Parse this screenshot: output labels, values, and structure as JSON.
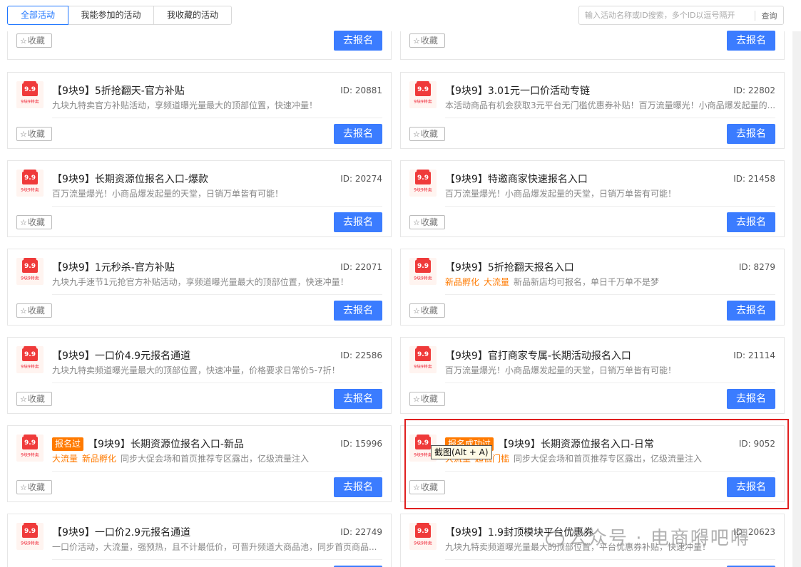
{
  "tabs": [
    {
      "label": "全部活动"
    },
    {
      "label": "我能参加的活动"
    },
    {
      "label": "我收藏的活动"
    }
  ],
  "search": {
    "placeholder": "输入活动名称或ID搜索，多个ID以逗号隔开",
    "button": "查询"
  },
  "common": {
    "fav_label": "收藏",
    "enroll_label": "去报名",
    "logo_text": "9.9",
    "logo_sub": "9块9特卖"
  },
  "cards": [
    {
      "title": "",
      "id": "",
      "desc": ""
    },
    {
      "title": "",
      "id": "",
      "desc": ""
    },
    {
      "title": "【9块9】5折抢翻天-官方补贴",
      "id": "ID: 20881",
      "desc": "九块九特卖官方补贴活动，享频道曝光量最大的顶部位置，快速冲量！"
    },
    {
      "title": "【9块9】3.01元一口价活动专链",
      "id": "ID: 22802",
      "desc": "本活动商品有机会获取3元平台无门槛优惠券补贴！百万流量曝光！小商品爆发起量的..."
    },
    {
      "title": "【9块9】长期资源位报名入口-爆款",
      "id": "ID: 20274",
      "desc": "百万流量爆光！小商品爆发起量的天堂，日销万单皆有可能！"
    },
    {
      "title": "【9块9】特邀商家快速报名入口",
      "id": "ID: 21458",
      "desc": "百万流量爆光！小商品爆发起量的天堂，日销万单皆有可能！"
    },
    {
      "title": "【9块9】1元秒杀-官方补贴",
      "id": "ID: 22071",
      "desc": "九块九手速节1元抢官方补贴活动，享频道曝光量最大的顶部位置，快速冲量！"
    },
    {
      "title": "【9块9】5折抢翻天报名入口",
      "id": "ID: 8279",
      "tags": [
        "新品孵化",
        "大流量"
      ],
      "desc": "新品新店均可报名，单日千万单不是梦"
    },
    {
      "title": "【9块9】一口价4.9元报名通道",
      "id": "ID: 22586",
      "desc": "九块九特卖频道曝光量最大的顶部位置，快速冲量，价格要求日常价5-7折！"
    },
    {
      "title": "【9块9】官打商家专属-长期活动报名入口",
      "id": "ID: 21114",
      "desc": "百万流量爆光！小商品爆发起量的天堂，日销万单皆有可能！"
    },
    {
      "badge": "报名过",
      "title": "【9块9】长期资源位报名入口-新品",
      "id": "ID: 15996",
      "tags": [
        "大流量",
        "新品孵化"
      ],
      "desc": "同步大促会场和首页推荐专区露出，亿级流量注入"
    },
    {
      "badge": "报名成功过",
      "title": "【9块9】长期资源位报名入口-日常",
      "id": "ID: 9052",
      "tags": [
        "大流量",
        "超低门槛"
      ],
      "desc": "同步大促会场和首页推荐专区露出，亿级流量注入"
    },
    {
      "title": "【9块9】一口价2.9元报名通道",
      "id": "ID: 22749",
      "desc": "一口价活动，大流量，强预热，且不计最低价，可晋升频道大商品池，同步首页商品..."
    },
    {
      "title": "【9块9】1.9封顶模块平台优惠券",
      "id": "ID: 20623",
      "desc": "九块九特卖频道曝光量最大的顶部位置，平台优惠券补贴，快速冲量！"
    }
  ],
  "tooltip": "截图(Alt + A)",
  "watermark": "公众号 · 电商嘚吧嘚"
}
